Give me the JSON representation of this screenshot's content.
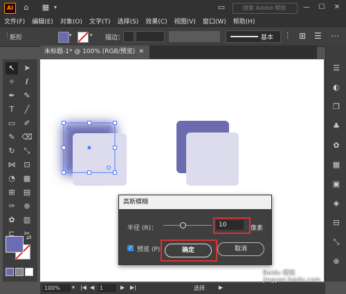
{
  "app": {
    "logo": "Ai",
    "search_placeholder": "搜索 Adobe 帮助"
  },
  "menu": [
    "文件(F)",
    "编辑(E)",
    "对象(O)",
    "文字(T)",
    "选择(S)",
    "效果(C)",
    "视图(V)",
    "窗口(W)",
    "帮助(H)"
  ],
  "control": {
    "object_type": "矩形",
    "stroke_label": "描边：",
    "style_label": "基本"
  },
  "document_tab": {
    "title": "未标题-1* @ 100% (RGB/预览)"
  },
  "dialog": {
    "title": "高斯模糊",
    "radius_label": "半径 (R)：",
    "radius_value": "10",
    "unit": "像素",
    "preview_label": "预览 (P)",
    "preview_checked": true,
    "ok_label": "确定",
    "cancel_label": "取消"
  },
  "status": {
    "zoom": "100%",
    "page": "1",
    "tool_name": "选择"
  },
  "colors": {
    "fill": "#6a6db5",
    "shape_light": "#dcdcec",
    "shape_dark": "#6b6bb0",
    "highlight": "#e03030"
  },
  "watermark": "Baidu 经验 jingyan.baidu.com"
}
